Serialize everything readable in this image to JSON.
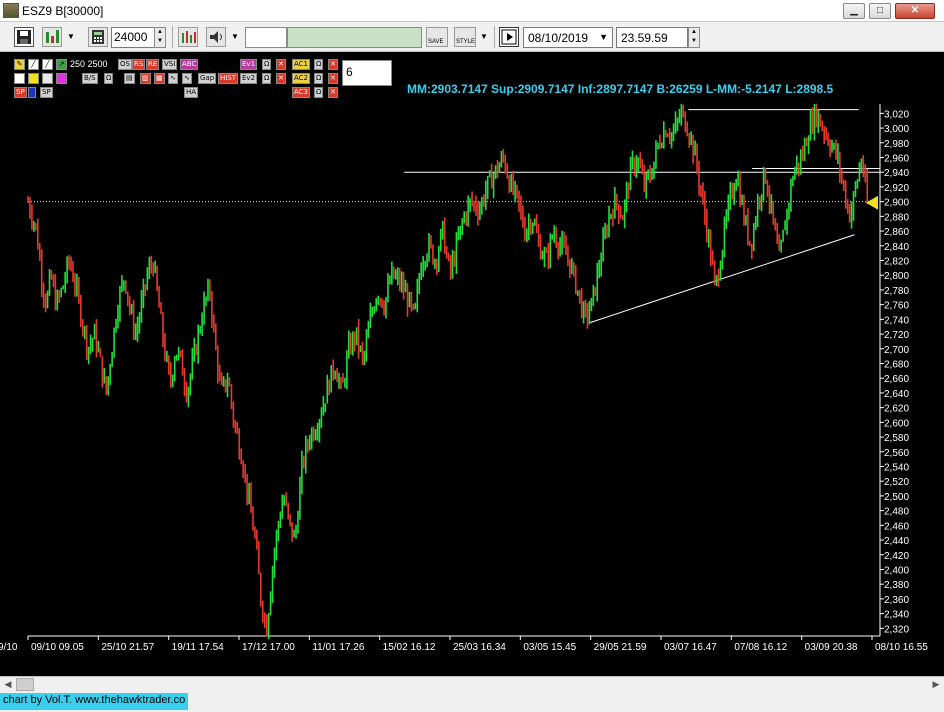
{
  "window": {
    "title": "ESZ9 B[30000]",
    "min_icon": "minimize-icon",
    "max_icon": "maximize-icon",
    "close_icon": "close-icon"
  },
  "toolbar": {
    "bar_size": "24000",
    "date": "08/10/2019",
    "time": "23.59.59",
    "save_icon": "save-icon",
    "cursor_icon": "crosshair-icon",
    "sound_icon": "speaker-icon",
    "play_icon": "play-icon",
    "save_label": "SAVE",
    "style_label": "STYLE"
  },
  "palette": {
    "row1_left_label": "250 2500",
    "buttons_row1": [
      "OS",
      "RS",
      "RE",
      "VSI",
      "ABC",
      "Ev1",
      "AC1"
    ],
    "buttons_row2": [
      "Gap",
      "HIST",
      "Ev2",
      "AC2"
    ],
    "buttons_row3": [
      "AC3"
    ],
    "small_labels": [
      "SP",
      "SP",
      "HA"
    ],
    "counter_value": "6"
  },
  "info_line": "MM:2903.7147 Sup:2909.7147 Inf:2897.7147 B:26259 L-MM:-5.2147 L:2898.5",
  "chart_data": {
    "type": "line",
    "symbol": "ESZ9",
    "y_ticks": [
      "3,020",
      "3,000",
      "2,980",
      "2,960",
      "2,940",
      "2,920",
      "2,900",
      "2,880",
      "2,860",
      "2,840",
      "2,820",
      "2,800",
      "2,780",
      "2,760",
      "2,740",
      "2,720",
      "2,700",
      "2,680",
      "2,660",
      "2,640",
      "2,620",
      "2,600",
      "2,580",
      "2,560",
      "2,540",
      "2,520",
      "2,500",
      "2,480",
      "2,460",
      "2,440",
      "2,420",
      "2,400",
      "2,380",
      "2,360",
      "2,340",
      "2,320"
    ],
    "ylim": [
      2315,
      3030
    ],
    "x_ticks": [
      "09/10 09.05",
      "25/10 21.57",
      "19/11 17.54",
      "17/12 17.00",
      "11/01 17.26",
      "15/02 16.12",
      "25/03 16.34",
      "03/05 15.45",
      "29/05 21.59",
      "03/07 16.47",
      "07/08 16.12",
      "03/09 20.38",
      "08/10 16.55"
    ],
    "x_ticks_first_prefix": "9/10",
    "last_price": 2898.5,
    "path_points": [
      [
        0,
        2900
      ],
      [
        0.6,
        2860
      ],
      [
        1.0,
        2790
      ],
      [
        1.3,
        2760
      ],
      [
        1.6,
        2800
      ],
      [
        2.0,
        2760
      ],
      [
        2.4,
        2780
      ],
      [
        2.9,
        2820
      ],
      [
        3.3,
        2790
      ],
      [
        3.8,
        2740
      ],
      [
        4.2,
        2700
      ],
      [
        4.7,
        2720
      ],
      [
        5.1,
        2680
      ],
      [
        5.5,
        2640
      ],
      [
        5.9,
        2700
      ],
      [
        6.3,
        2760
      ],
      [
        6.8,
        2800
      ],
      [
        7.2,
        2750
      ],
      [
        7.6,
        2720
      ],
      [
        8.0,
        2760
      ],
      [
        8.4,
        2800
      ],
      [
        8.8,
        2820
      ],
      [
        9.2,
        2760
      ],
      [
        9.6,
        2700
      ],
      [
        10.0,
        2650
      ],
      [
        10.4,
        2700
      ],
      [
        10.8,
        2680
      ],
      [
        11.2,
        2640
      ],
      [
        11.6,
        2680
      ],
      [
        12.0,
        2720
      ],
      [
        12.4,
        2760
      ],
      [
        12.8,
        2780
      ],
      [
        13.2,
        2700
      ],
      [
        13.6,
        2640
      ],
      [
        14.1,
        2660
      ],
      [
        14.5,
        2600
      ],
      [
        15.0,
        2560
      ],
      [
        15.5,
        2500
      ],
      [
        16.0,
        2440
      ],
      [
        16.4,
        2360
      ],
      [
        16.8,
        2320
      ],
      [
        17.2,
        2400
      ],
      [
        17.6,
        2460
      ],
      [
        18.0,
        2500
      ],
      [
        18.4,
        2460
      ],
      [
        18.8,
        2440
      ],
      [
        19.3,
        2540
      ],
      [
        19.8,
        2580
      ],
      [
        20.4,
        2600
      ],
      [
        21.0,
        2640
      ],
      [
        21.6,
        2680
      ],
      [
        22.1,
        2640
      ],
      [
        22.6,
        2700
      ],
      [
        23.1,
        2720
      ],
      [
        23.6,
        2680
      ],
      [
        24.1,
        2740
      ],
      [
        24.6,
        2780
      ],
      [
        25.1,
        2760
      ],
      [
        25.6,
        2800
      ],
      [
        26.2,
        2790
      ],
      [
        26.7,
        2770
      ],
      [
        27.2,
        2740
      ],
      [
        27.7,
        2820
      ],
      [
        28.2,
        2840
      ],
      [
        28.7,
        2820
      ],
      [
        29.2,
        2860
      ],
      [
        29.7,
        2800
      ],
      [
        30.2,
        2840
      ],
      [
        30.7,
        2880
      ],
      [
        31.2,
        2900
      ],
      [
        31.8,
        2890
      ],
      [
        32.3,
        2920
      ],
      [
        32.9,
        2940
      ],
      [
        33.5,
        2960
      ],
      [
        34.0,
        2920
      ],
      [
        34.5,
        2900
      ],
      [
        35.0,
        2860
      ],
      [
        35.5,
        2880
      ],
      [
        36.0,
        2840
      ],
      [
        36.5,
        2820
      ],
      [
        37.0,
        2860
      ],
      [
        37.5,
        2840
      ],
      [
        38.1,
        2820
      ],
      [
        38.7,
        2780
      ],
      [
        39.2,
        2740
      ],
      [
        39.7,
        2760
      ],
      [
        40.3,
        2820
      ],
      [
        40.9,
        2880
      ],
      [
        41.4,
        2900
      ],
      [
        41.9,
        2880
      ],
      [
        42.4,
        2940
      ],
      [
        42.9,
        2960
      ],
      [
        43.4,
        2920
      ],
      [
        43.9,
        2940
      ],
      [
        44.4,
        2980
      ],
      [
        44.9,
        3000
      ],
      [
        45.4,
        2990
      ],
      [
        46.0,
        3020
      ],
      [
        46.5,
        3000
      ],
      [
        47.0,
        2960
      ],
      [
        47.5,
        2900
      ],
      [
        48.0,
        2840
      ],
      [
        48.4,
        2780
      ],
      [
        48.9,
        2840
      ],
      [
        49.4,
        2900
      ],
      [
        49.9,
        2940
      ],
      [
        50.4,
        2880
      ],
      [
        50.9,
        2840
      ],
      [
        51.4,
        2900
      ],
      [
        51.9,
        2940
      ],
      [
        52.4,
        2880
      ],
      [
        52.9,
        2820
      ],
      [
        53.4,
        2880
      ],
      [
        53.9,
        2940
      ],
      [
        54.5,
        2960
      ],
      [
        55.0,
        3000
      ],
      [
        55.5,
        3020
      ],
      [
        56.0,
        3000
      ],
      [
        56.5,
        2980
      ],
      [
        57.0,
        2960
      ],
      [
        57.4,
        2920
      ],
      [
        57.9,
        2880
      ],
      [
        58.3,
        2920
      ],
      [
        58.7,
        2960
      ],
      [
        59.1,
        2898.5
      ]
    ],
    "support_line": {
      "from": [
        39.5,
        2735
      ],
      "to": [
        58.2,
        2855
      ]
    },
    "resistance_lines": [
      2945,
      2940
    ],
    "top_line": 3025,
    "mm_line": 2900,
    "colors": {
      "background": "#000000",
      "up": "#22e03a",
      "down": "#e83a2a",
      "axis_text": "#ffffff",
      "info_text": "#36d0f0",
      "marker": "#f0e020"
    }
  },
  "status": {
    "credit": "chart by Vol.T. www.thehawktrader.co"
  }
}
